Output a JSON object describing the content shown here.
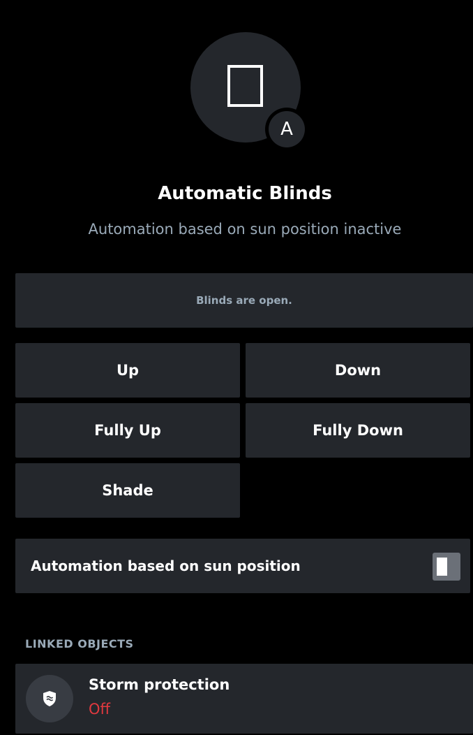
{
  "header": {
    "icon": "window-blind-icon",
    "badge_letter": "A",
    "title": "Automatic Blinds",
    "subtitle": "Automation based on sun position inactive"
  },
  "status": {
    "text": "Blinds are open."
  },
  "controls": {
    "up": "Up",
    "down": "Down",
    "fully_up": "Fully Up",
    "fully_down": "Fully Down",
    "shade": "Shade"
  },
  "automation": {
    "label": "Automation based on sun position",
    "enabled": false
  },
  "linked": {
    "section_label": "LINKED OBJECTS",
    "items": [
      {
        "icon": "storm-shield-icon",
        "title": "Storm protection",
        "status": "Off",
        "status_color": "#e0393f"
      }
    ]
  },
  "colors": {
    "background": "#000000",
    "tile": "#24272c",
    "muted_text": "#9aaab8",
    "off_red": "#e0393f"
  }
}
